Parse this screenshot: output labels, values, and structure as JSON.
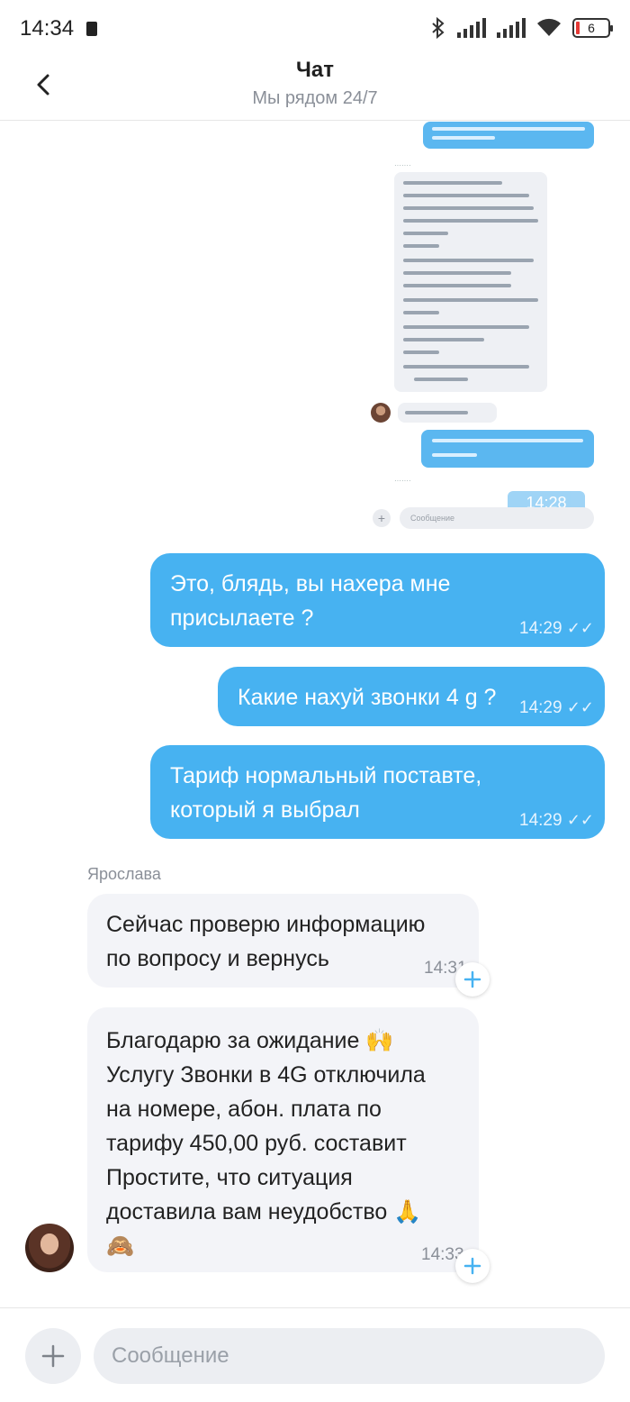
{
  "status_bar": {
    "time": "14:34",
    "battery": "6"
  },
  "header": {
    "title": "Чат",
    "subtitle": "Мы рядом 24/7"
  },
  "embedded_screenshot": {
    "time": "14:28"
  },
  "messages": [
    {
      "side": "out",
      "text_lines": [
        "Это, блядь, вы нахера мне",
        "присылаете ?"
      ],
      "time": "14:29"
    },
    {
      "side": "out",
      "text_lines": [
        "Какие нахуй звонки 4 g ?"
      ],
      "time": "14:29"
    },
    {
      "side": "out",
      "text_lines": [
        "Тариф нормальный поставте,",
        "который я выбрал"
      ],
      "time": "14:29"
    },
    {
      "side": "in",
      "sender": "Ярослава",
      "text_lines": [
        "Сейчас проверю информацию",
        "по вопросу и вернусь"
      ],
      "time": "14:31"
    },
    {
      "side": "in",
      "text_lines": [
        "Благодарю за ожидание 🙌",
        "Услугу Звонки в 4G отключила",
        "на номере, абон. плата по",
        "тарифу 450,00 руб. составит",
        "Простите, что ситуация",
        "доставила вам неудобство 🙏",
        "🙈"
      ],
      "time": "14:33"
    }
  ],
  "composer": {
    "placeholder": "Сообщение"
  },
  "colors": {
    "outgoing_bubble": "#47b2f1",
    "incoming_bubble": "#f3f4f8",
    "accent": "#47b2f1"
  },
  "icons": {
    "back": "chevron-left-icon",
    "add": "plus-icon",
    "read": "double-check-icon",
    "react": "add-reaction-icon"
  }
}
